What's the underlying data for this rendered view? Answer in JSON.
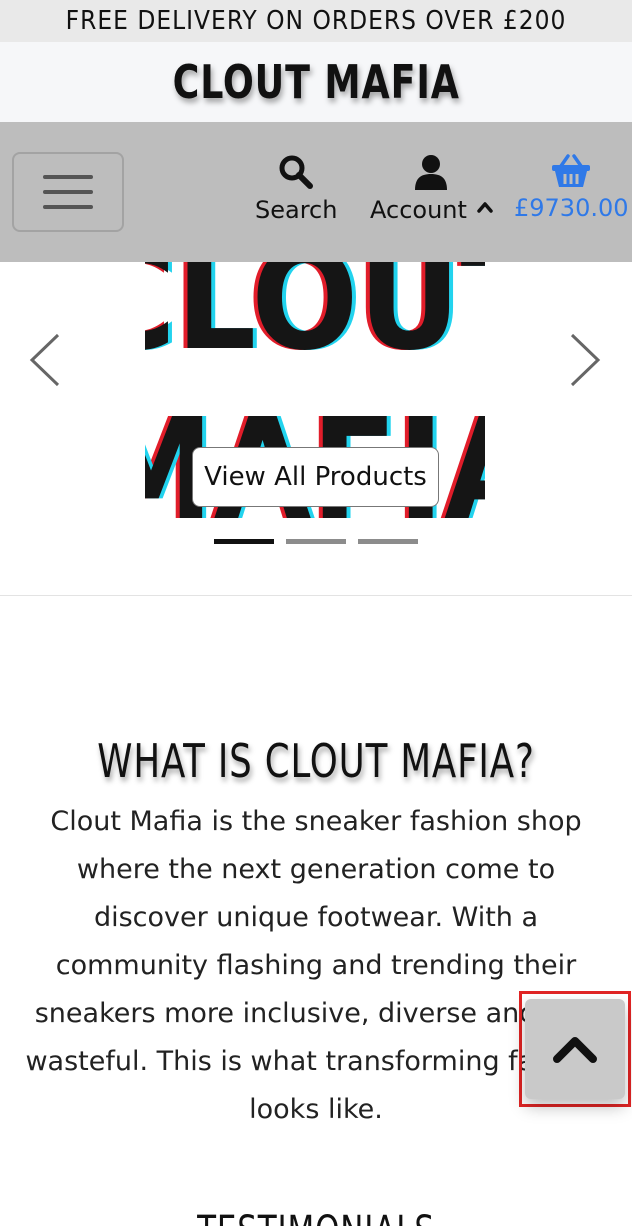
{
  "banner": {
    "text": "FREE DELIVERY ON ORDERS OVER £200"
  },
  "brand": {
    "name": "CLOUT MAFIA"
  },
  "nav": {
    "menu_icon": "hamburger-menu-icon",
    "search": {
      "label": "Search",
      "icon": "search-icon"
    },
    "account": {
      "label": "Account",
      "icon": "user-icon",
      "caret_icon": "chevron-up-icon"
    },
    "cart": {
      "total": "£9730.00",
      "icon": "basket-icon",
      "color": "#2f79e8"
    }
  },
  "carousel": {
    "logo_text_line1": "CLOUT",
    "logo_text_line2": "MAFIA",
    "prev_icon": "chevron-left-icon",
    "next_icon": "chevron-right-icon",
    "button_label": "View All Products",
    "slides": 3,
    "active_slide": 1
  },
  "about": {
    "heading": "WHAT IS CLOUT MAFIA?",
    "body": "Clout Mafia is the sneaker fashion shop where the next generation come to discover unique footwear. With a community flashing and trending their sneakers more inclusive, diverse and less wasteful. This is what transforming fashion looks like."
  },
  "testimonials": {
    "heading": "TESTIMONIALS"
  },
  "back_to_top": {
    "icon": "chevron-up-icon",
    "highlight_color": "#e02424"
  }
}
